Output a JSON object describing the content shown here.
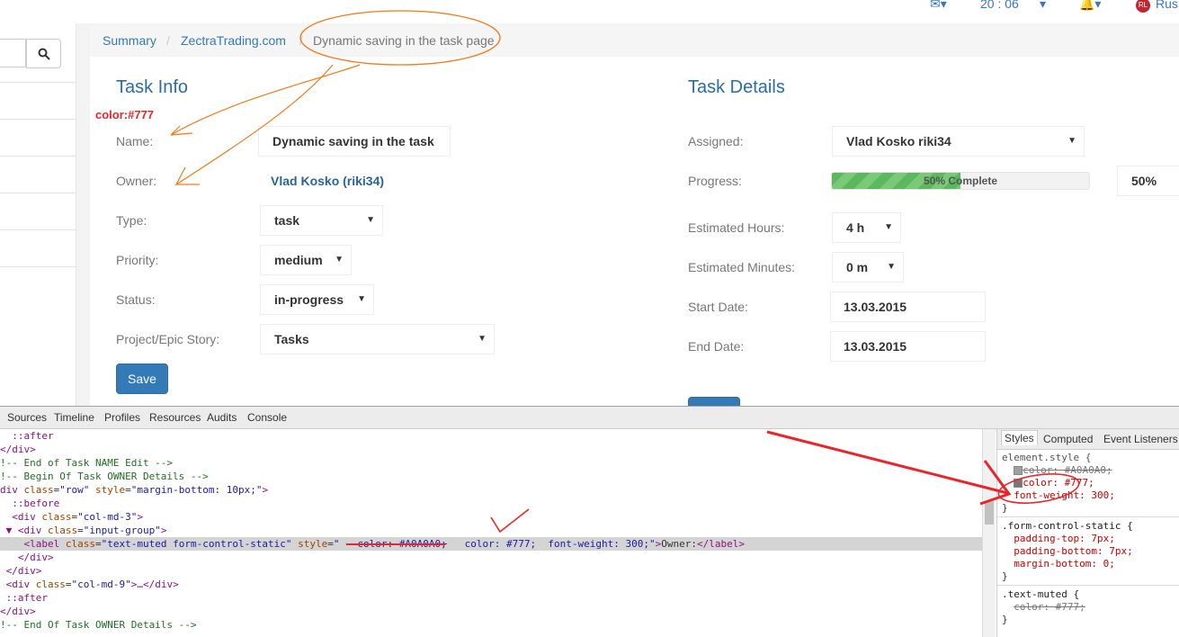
{
  "topbar": {
    "clock": "20 : 06",
    "user_initials": "RL",
    "user_name": "Rus"
  },
  "breadcrumb": {
    "items": [
      "Summary",
      "ZectraTrading.com"
    ],
    "separator": "/",
    "active": "Dynamic saving in the task page"
  },
  "task_info": {
    "title": "Task Info",
    "name_label": "Name:",
    "name_value": "Dynamic saving in the task",
    "owner_label": "Owner:",
    "owner_value": "Vlad Kosko (riki34)",
    "type_label": "Type:",
    "type_value": "task",
    "priority_label": "Priority:",
    "priority_value": "medium",
    "status_label": "Status:",
    "status_value": "in-progress",
    "project_label": "Project/Epic Story:",
    "project_value": "Tasks",
    "save_label": "Save"
  },
  "task_details": {
    "title": "Task Details",
    "assigned_label": "Assigned:",
    "assigned_value": "Vlad Kosko riki34",
    "progress_label": "Progress:",
    "progress_fraction": 0.5,
    "progress_text": "50% Complete",
    "progress_value": "50%",
    "hours_label": "Estimated Hours:",
    "hours_value": "4 h",
    "minutes_label": "Estimated Minutes:",
    "minutes_value": "0 m",
    "start_label": "Start Date:",
    "start_value": "13.03.2015",
    "end_label": "End Date:",
    "end_value": "13.03.2015"
  },
  "annotation": {
    "color_note": "color:#777"
  },
  "devtools": {
    "tabs": [
      "Sources",
      "Timeline",
      "Profiles",
      "Resources",
      "Audits",
      "Console"
    ],
    "styles_tabs": [
      "Styles",
      "Computed",
      "Event Listeners"
    ],
    "dom": {
      "l1": "::after",
      "l2": "</div>",
      "l3": "!-- End of Task NAME Edit -->",
      "l4": "!-- Begin Of Task OWNER Details -->",
      "l5_tag": "div",
      "l5_attr": "class",
      "l5_val": "\"row\"",
      "l5_attr2": "style",
      "l5_val2": "\"margin-bottom: 10px;\"",
      "l6": "::before",
      "l7_val": "\"col-md-3\"",
      "l8_val": "\"input-group\"",
      "l9_class": "\"text-muted form-control-static\"",
      "l9_style_open": "\"",
      "l9_struck": "color: #A0A0A0;",
      "l9_color": "color: #777;",
      "l9_weight": "font-weight: 300;",
      "l9_text": "Owner:",
      "l10": "</div>",
      "l11": "</div>",
      "l12_val": "\"col-md-9\"",
      "l12_rest": "…</div>",
      "l13": "::after",
      "l14": "</div>",
      "l15": "!-- End Of Task OWNER Details -->"
    },
    "styles": {
      "r1_selector": "element.style {",
      "r1_p1": "color: #A0A0A0;",
      "r1_p2": "color: #777;",
      "r1_p3": "font-weight: 300;",
      "close": "}",
      "r2_selector": ".form-control-static {",
      "r2_p1": "padding-top: 7px;",
      "r2_p2": "padding-bottom: 7px;",
      "r2_p3": "margin-bottom: 0;",
      "r3_selector": ".text-muted {",
      "r3_p1": "color: #777;"
    }
  },
  "colors": {
    "accent": "#337ab7",
    "label": "#777777",
    "annotation_red": "#e8262a",
    "annotation_orange": "#f07a1e",
    "progress": "#5cb85c"
  }
}
